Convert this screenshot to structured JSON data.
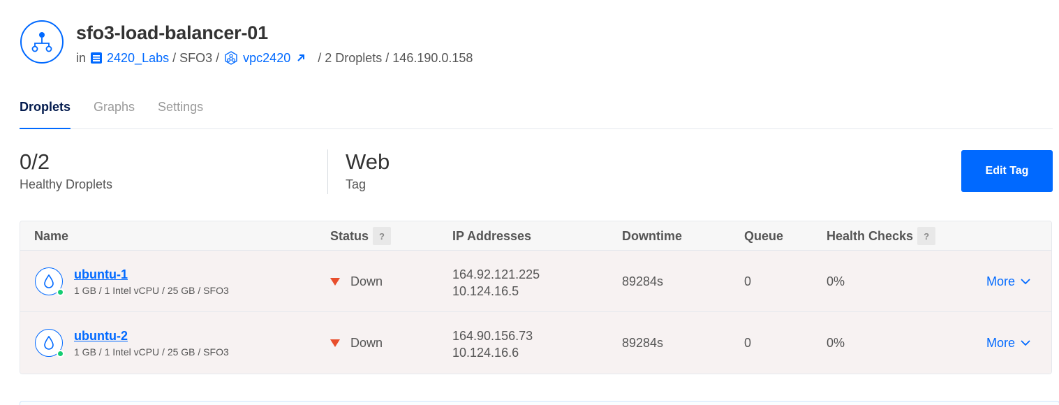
{
  "header": {
    "title": "sfo3-load-balancer-01",
    "in_label": "in",
    "project": "2420_Labs",
    "region": "SFO3",
    "vpc": "vpc2420",
    "droplet_count": "2 Droplets",
    "ip": "146.190.0.158"
  },
  "tabs": [
    {
      "label": "Droplets",
      "active": true
    },
    {
      "label": "Graphs",
      "active": false
    },
    {
      "label": "Settings",
      "active": false
    }
  ],
  "summary": {
    "healthy_value": "0/2",
    "healthy_label": "Healthy Droplets",
    "tag_value": "Web",
    "tag_label": "Tag",
    "edit_tag_label": "Edit Tag"
  },
  "table": {
    "columns": {
      "name": "Name",
      "status": "Status",
      "ips": "IP Addresses",
      "downtime": "Downtime",
      "queue": "Queue",
      "health": "Health Checks"
    },
    "help_glyph": "?",
    "rows": [
      {
        "name": "ubuntu-1",
        "spec": "1 GB / 1 Intel vCPU / 25 GB / SFO3",
        "status": "Down",
        "public_ip": "164.92.121.225",
        "private_ip": "10.124.16.5",
        "downtime": "89284s",
        "queue": "0",
        "health": "0%",
        "more": "More"
      },
      {
        "name": "ubuntu-2",
        "spec": "1 GB / 1 Intel vCPU / 25 GB / SFO3",
        "status": "Down",
        "public_ip": "164.90.156.73",
        "private_ip": "10.124.16.6",
        "downtime": "89284s",
        "queue": "0",
        "health": "0%",
        "more": "More"
      }
    ]
  },
  "colors": {
    "accent": "#0069ff",
    "down": "#e84e2c",
    "online_dot": "#15cd72"
  },
  "icons": {
    "load_balancer": "load-balancer-icon",
    "project": "project-icon",
    "vpc": "vpc-icon",
    "external_link": "external-link-icon",
    "droplet": "droplet-icon",
    "status_down": "triangle-down-icon",
    "more": "chevron-down-icon"
  }
}
